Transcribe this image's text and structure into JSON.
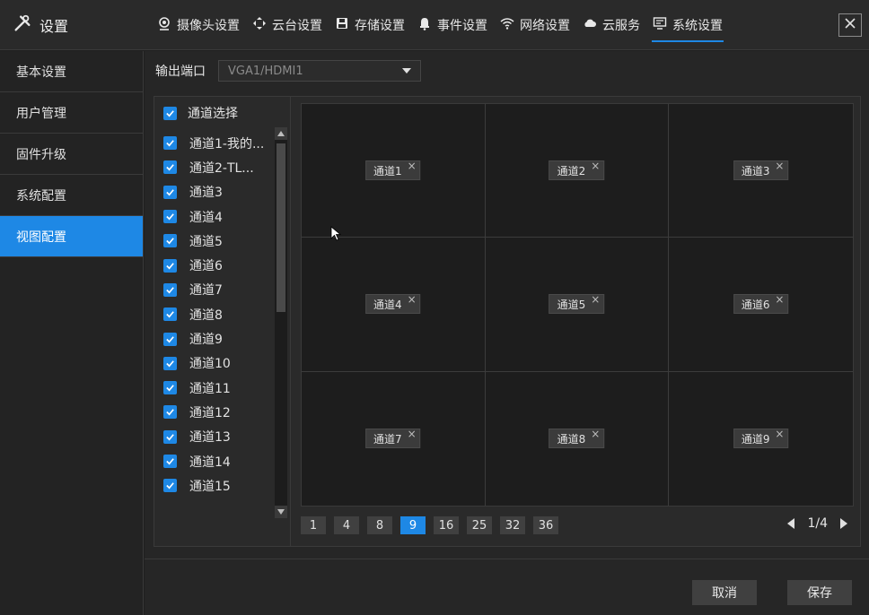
{
  "brand": {
    "label": "设置",
    "icon": "tools-icon"
  },
  "tabs": [
    {
      "label": "摄像头设置",
      "icon": "camera-icon"
    },
    {
      "label": "云台设置",
      "icon": "ptz-icon"
    },
    {
      "label": "存储设置",
      "icon": "save-icon"
    },
    {
      "label": "事件设置",
      "icon": "bell-icon"
    },
    {
      "label": "网络设置",
      "icon": "wifi-icon"
    },
    {
      "label": "云服务",
      "icon": "cloud-icon"
    },
    {
      "label": "系统设置",
      "icon": "monitor-icon",
      "active": true
    }
  ],
  "sidebar": {
    "items": [
      {
        "label": "基本设置"
      },
      {
        "label": "用户管理"
      },
      {
        "label": "固件升级"
      },
      {
        "label": "系统配置"
      },
      {
        "label": "视图配置",
        "active": true
      }
    ]
  },
  "output_port": {
    "label": "输出端口",
    "value": "VGA1/HDMI1"
  },
  "channels": {
    "select_all": "通道选择",
    "items": [
      "通道1-我的...",
      "通道2-TL...",
      "通道3",
      "通道4",
      "通道5",
      "通道6",
      "通道7",
      "通道8",
      "通道9",
      "通道10",
      "通道11",
      "通道12",
      "通道13",
      "通道14",
      "通道15"
    ]
  },
  "grid": {
    "cells": [
      "通道1",
      "通道2",
      "通道3",
      "通道4",
      "通道5",
      "通道6",
      "通道7",
      "通道8",
      "通道9"
    ],
    "close_glyph": "×"
  },
  "layouts": {
    "options": [
      "1",
      "4",
      "8",
      "9",
      "16",
      "25",
      "32",
      "36"
    ],
    "selected": "9"
  },
  "pager": {
    "text": "1/4"
  },
  "buttons": {
    "cancel": "取消",
    "save": "保存"
  },
  "colors": {
    "accent": "#1e88e5",
    "background": "#1f1f1f"
  }
}
